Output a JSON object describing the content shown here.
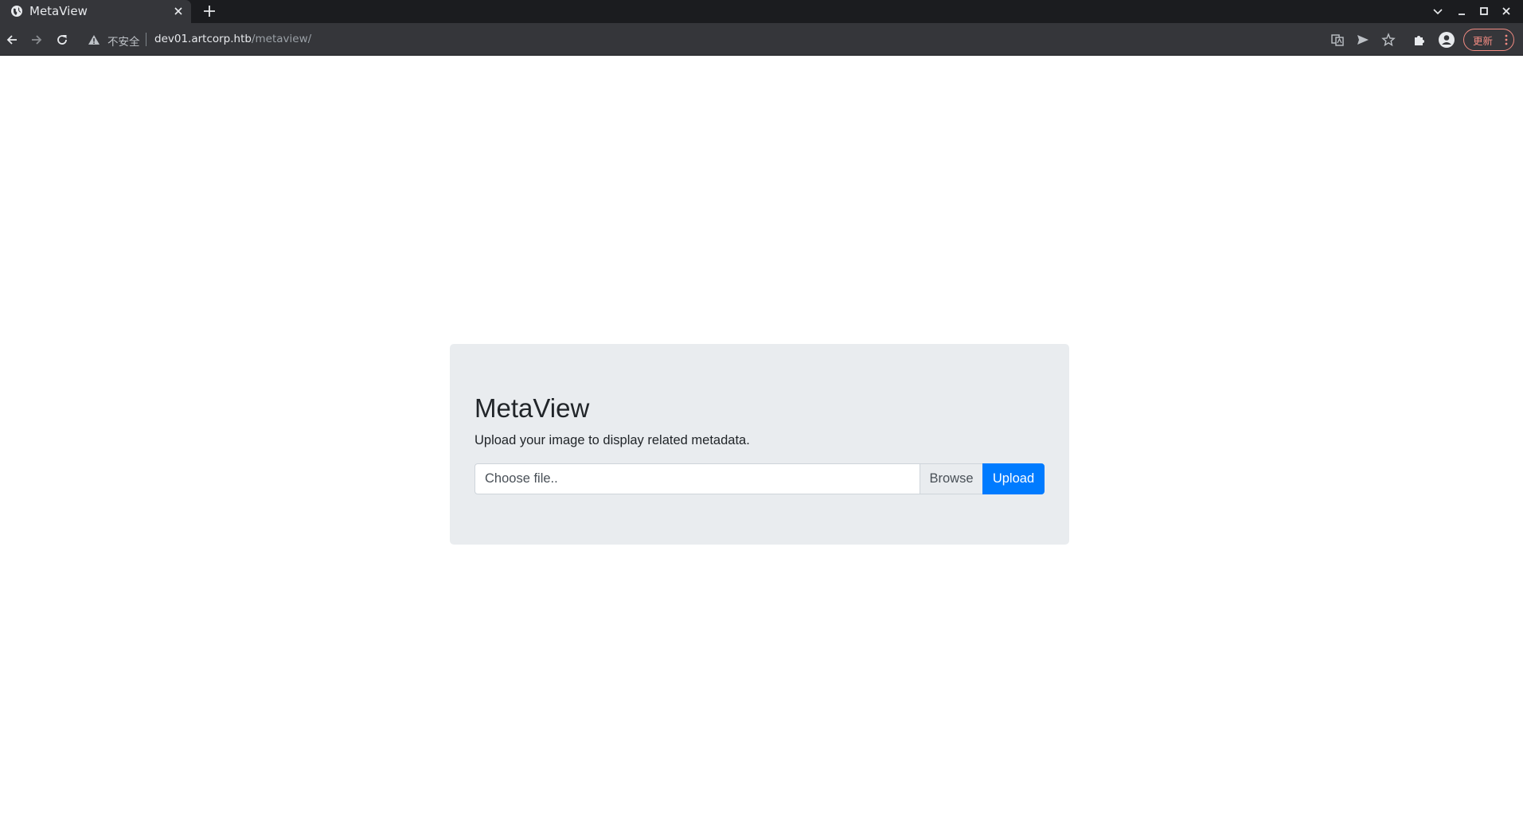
{
  "browser": {
    "tab": {
      "title": "MetaView",
      "favicon": "globe-icon"
    },
    "address_bar": {
      "security_label": "不安全",
      "host": "dev01.artcorp.htb",
      "path": "/metaview/"
    },
    "update_button_label": "更新",
    "icons": [
      "back-icon",
      "forward-icon",
      "reload-icon",
      "warning-icon",
      "translate-icon",
      "send-icon",
      "star-icon",
      "extensions-icon",
      "profile-icon",
      "more-icon"
    ]
  },
  "page": {
    "title": "MetaView",
    "lead": "Upload your image to display related metadata.",
    "file_input": {
      "placeholder": "Choose file..",
      "browse_label": "Browse"
    },
    "upload_label": "Upload"
  },
  "colors": {
    "primary": "#007bff",
    "jumbotron_bg": "#e9ecef",
    "chrome_dark": "#35363a",
    "tabbar_bg": "#1b1c1f",
    "update_accent": "#f28b82"
  }
}
